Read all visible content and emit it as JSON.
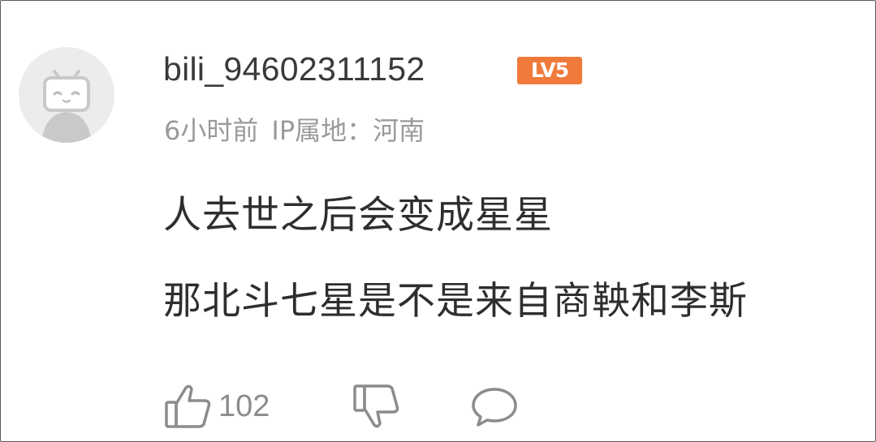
{
  "comment": {
    "avatar_icon": "bilibili-tv-default-avatar",
    "username": "bili_94602311152",
    "level_badge": "LV5",
    "time_ago": "6小时前",
    "ip_location": "IP属地：河南",
    "lines": [
      "人去世之后会变成星星",
      "那北斗七星是不是来自商鞅和李斯"
    ],
    "actions": {
      "like_icon": "thumbs-up-icon",
      "like_count": "102",
      "dislike_icon": "thumbs-down-icon",
      "reply_icon": "speech-bubble-icon"
    }
  },
  "colors": {
    "badge": "#f07a3a",
    "meta_text": "#9a9a9a",
    "body_text": "#2e2e2e",
    "icon_stroke": "#8c8c8c"
  }
}
